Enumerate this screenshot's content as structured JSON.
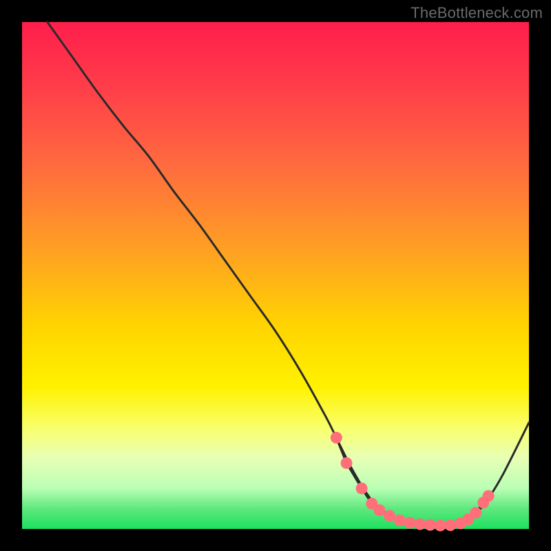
{
  "watermark": "TheBottleneck.com",
  "colors": {
    "background": "#000000",
    "curve": "#2a2a2a",
    "bead": "#ff6f7a"
  },
  "chart_data": {
    "type": "line",
    "title": "",
    "xlabel": "",
    "ylabel": "",
    "xlim": [
      0,
      100
    ],
    "ylim": [
      0,
      100
    ],
    "series": [
      {
        "name": "curve",
        "x": [
          5,
          10,
          15,
          20,
          25,
          30,
          35,
          40,
          45,
          50,
          55,
          60,
          62,
          65,
          68,
          70,
          72,
          74,
          76,
          78,
          80,
          82,
          84,
          86,
          88,
          90,
          92,
          95,
          100
        ],
        "y": [
          100,
          93,
          86,
          79.5,
          73.5,
          66.5,
          60,
          53,
          46,
          39,
          31,
          22,
          18,
          12,
          7,
          4.5,
          3,
          2,
          1.4,
          1,
          0.8,
          0.7,
          0.7,
          0.9,
          1.8,
          3.5,
          6,
          11,
          21
        ]
      }
    ],
    "markers": [
      {
        "x": 62.0,
        "y": 18.0
      },
      {
        "x": 64.0,
        "y": 13.0
      },
      {
        "x": 67.0,
        "y": 8.0
      },
      {
        "x": 69.0,
        "y": 5.0
      },
      {
        "x": 70.5,
        "y": 3.7
      },
      {
        "x": 72.5,
        "y": 2.6
      },
      {
        "x": 74.5,
        "y": 1.7
      },
      {
        "x": 76.5,
        "y": 1.2
      },
      {
        "x": 78.5,
        "y": 0.95
      },
      {
        "x": 80.5,
        "y": 0.8
      },
      {
        "x": 82.5,
        "y": 0.7
      },
      {
        "x": 84.5,
        "y": 0.75
      },
      {
        "x": 86.5,
        "y": 1.1
      },
      {
        "x": 88.0,
        "y": 1.9
      },
      {
        "x": 89.5,
        "y": 3.2
      },
      {
        "x": 91.0,
        "y": 5.2
      },
      {
        "x": 92.0,
        "y": 6.5
      }
    ]
  }
}
